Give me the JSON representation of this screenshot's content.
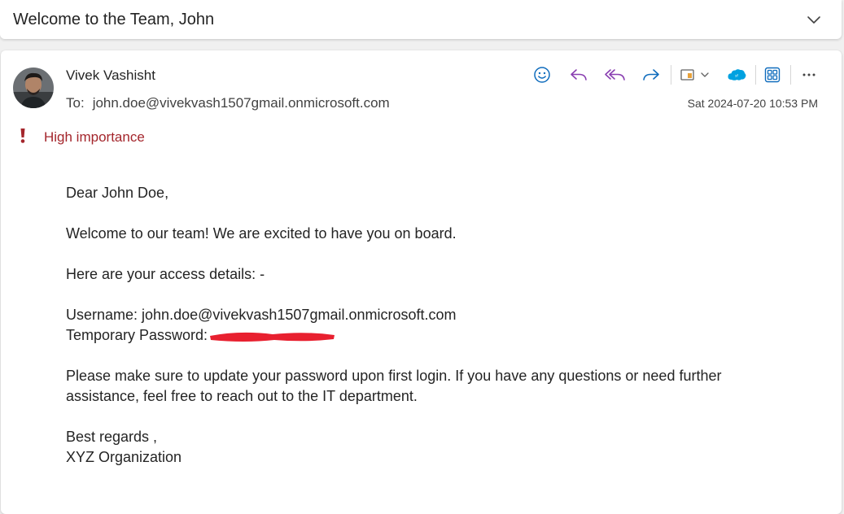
{
  "subject": "Welcome to the Team, John",
  "email": {
    "sender": "Vivek Vashisht",
    "to_label": "To:",
    "to_address": "john.doe@vivekvash1507gmail.onmicrosoft.com",
    "datetime": "Sat 2024-07-20 10:53 PM",
    "importance": "High importance",
    "greeting": "Dear John Doe,",
    "line1": "Welcome to our team! We are excited to have you on board.",
    "line2": "Here are your access details: -",
    "username_line": "Username: john.doe@vivekvash1507gmail.onmicrosoft.com",
    "password_label": "Temporary Password:",
    "line3": "Please make sure to update your password upon first login. If you have any questions or need further assistance, feel free to reach out to the IT department.",
    "closing": "Best regards ,",
    "signature": "XYZ Organization"
  },
  "toolbar_icons": [
    "emoji-icon",
    "reply-icon",
    "reply-all-icon",
    "forward-icon",
    "immersive-reader-icon",
    "salesforce-icon",
    "apps-icon",
    "more-icon"
  ],
  "colors": {
    "accent": "#0f6cbd",
    "reply_purple": "#8a3fb1",
    "importance_red": "#a4262c",
    "redaction_red": "#e8202f",
    "salesforce_blue": "#00a1e0"
  }
}
